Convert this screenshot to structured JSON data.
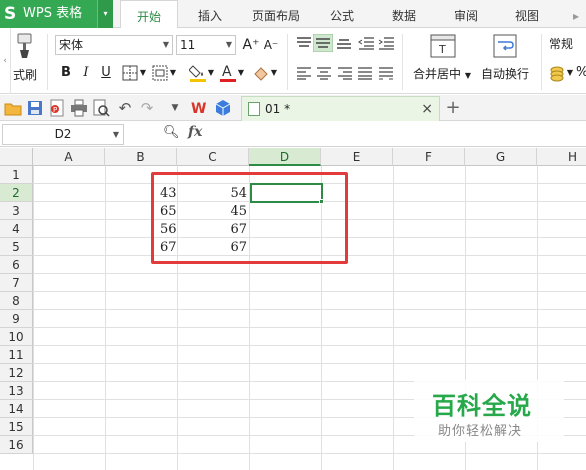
{
  "app": {
    "title": "WPS 表格",
    "logo_letter": "S",
    "dropdown": "▾"
  },
  "menu": {
    "tabs": [
      {
        "label": "开始"
      },
      {
        "label": "插入"
      },
      {
        "label": "页面布局"
      },
      {
        "label": "公式"
      },
      {
        "label": "数据"
      },
      {
        "label": "审阅"
      },
      {
        "label": "视图"
      }
    ]
  },
  "ribbon": {
    "format_painter": "式刷",
    "font_name": "宋体",
    "font_size": "11",
    "grow_font": "A⁺",
    "shrink_font": "A⁻",
    "bold": "B",
    "italic": "I",
    "underline": "U",
    "merge_center": "合并居中",
    "wrap_text": "自动换行",
    "number_format": "常规",
    "percent": "%"
  },
  "document": {
    "tab_name": "01 *",
    "close": "×",
    "new_tab": "+"
  },
  "formula_bar": {
    "name_box": "D2",
    "fx": "fx",
    "formula": ""
  },
  "sheet": {
    "columns": [
      "A",
      "B",
      "C",
      "D",
      "E",
      "F",
      "G",
      "H"
    ],
    "rows": [
      "1",
      "2",
      "3",
      "4",
      "5",
      "6",
      "7",
      "8",
      "9",
      "10",
      "11",
      "12",
      "13",
      "14",
      "15",
      "16"
    ],
    "selected_column": "D",
    "selected_row": "2",
    "data": [
      {
        "b": "43",
        "c": "54"
      },
      {
        "b": "65",
        "c": "45"
      },
      {
        "b": "56",
        "c": "67"
      },
      {
        "b": "67",
        "c": "67"
      }
    ]
  },
  "watermark": {
    "title": "百科全说",
    "subtitle": "助你轻松解决"
  },
  "colors": {
    "accent": "#2e8b45",
    "highlight": "#e23b3b"
  }
}
